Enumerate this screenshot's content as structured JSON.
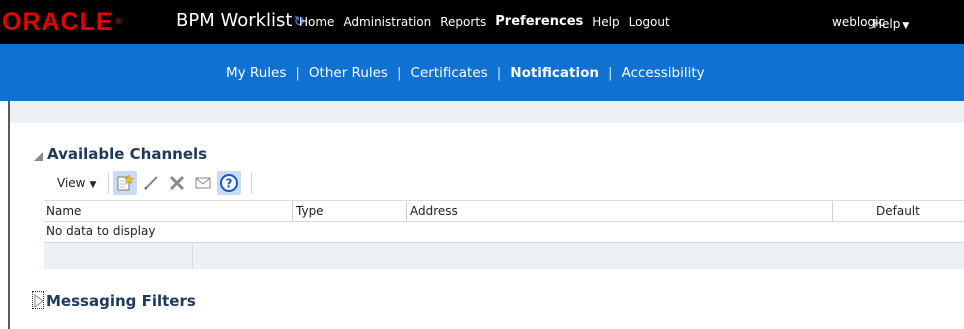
{
  "header": {
    "logo_text": "ORACLE",
    "app_title": "BPM Worklist",
    "nav": [
      "Home",
      "Administration",
      "Reports",
      "Preferences",
      "Help",
      "Logout"
    ],
    "active_nav": "Preferences",
    "user": "weblogic",
    "help_menu": "Help"
  },
  "subnav": {
    "items": [
      "My Rules",
      "Other Rules",
      "Certificates",
      "Notification",
      "Accessibility"
    ],
    "active": "Notification"
  },
  "available_channels": {
    "title": "Available Channels",
    "view_menu": "View",
    "toolbar_icons": [
      "create-icon",
      "edit-icon",
      "delete-icon",
      "email-icon",
      "help-icon"
    ],
    "columns": [
      "Name",
      "Type",
      "Address",
      "Default"
    ],
    "empty_text": "No data to display"
  },
  "messaging_filters": {
    "title": "Messaging Filters"
  },
  "colors": {
    "topbar": "#000000",
    "subnav": "#0f72d2",
    "logo": "#e20000",
    "section_title": "#1b3a5c"
  }
}
